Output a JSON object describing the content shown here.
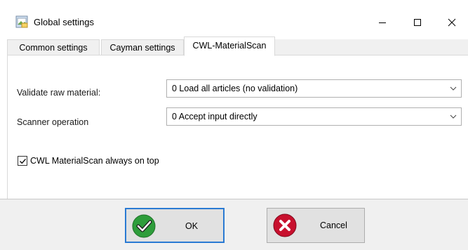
{
  "window": {
    "title": "Global settings",
    "icon": "settings-window-icon",
    "controls": [
      "minimize",
      "maximize",
      "close"
    ]
  },
  "tabs": [
    {
      "label": "Common settings",
      "selected": false
    },
    {
      "label": "Cayman settings",
      "selected": false
    },
    {
      "label": "CWL-MaterialScan",
      "selected": true
    }
  ],
  "form": {
    "validate_label": "Validate raw material:",
    "validate_value": "0 Load all articles (no validation)",
    "scanner_label": "Scanner operation",
    "scanner_value": "0 Accept input directly",
    "always_on_top_label": "CWL MaterialScan always on top",
    "always_on_top_checked": true
  },
  "buttons": {
    "ok_label": "OK",
    "cancel_label": "Cancel"
  },
  "colors": {
    "ok_green": "#2e9d3b",
    "cancel_red": "#c8102e",
    "focus_blue": "#2a7ad3"
  }
}
